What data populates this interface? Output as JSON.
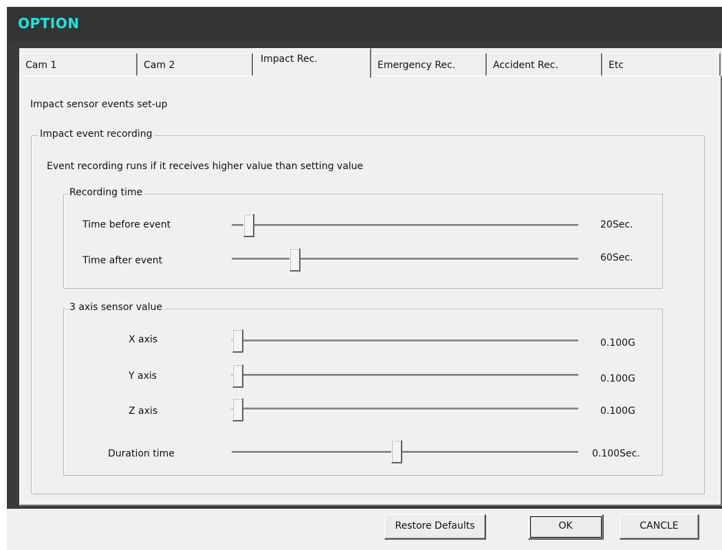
{
  "window": {
    "title": "OPTION",
    "title_color": "#1ee3e3"
  },
  "tabs": [
    {
      "label": "Cam 1",
      "active": false
    },
    {
      "label": "Cam 2",
      "active": false
    },
    {
      "label": "Impact Rec.",
      "active": true
    },
    {
      "label": "Emergency Rec.",
      "active": false
    },
    {
      "label": "Accident Rec.",
      "active": false
    },
    {
      "label": "Etc",
      "active": false
    }
  ],
  "panel": {
    "heading": "Impact sensor events set-up",
    "impact_group": {
      "legend": "Impact event recording",
      "description": "Event recording runs if it receives higher value than setting value",
      "recording_time": {
        "legend": "Recording time",
        "sliders": [
          {
            "label": "Time before event",
            "value_text": "20Sec.",
            "position": 0.06
          },
          {
            "label": "Time after event",
            "value_text": "60Sec.",
            "position": 0.19
          }
        ]
      },
      "sensor": {
        "legend": "3 axis sensor value",
        "sliders": [
          {
            "label": "X axis",
            "value_text": "0.100G",
            "position": 0.0
          },
          {
            "label": "Y axis",
            "value_text": "0.100G",
            "position": 0.0
          },
          {
            "label": "Z axis",
            "value_text": "0.100G",
            "position": 0.0
          },
          {
            "label": "Duration time",
            "value_text": "0.100Sec.",
            "position": 0.47
          }
        ]
      }
    }
  },
  "buttons": {
    "restore": "Restore Defaults",
    "ok": "OK",
    "cancel": "CANCLE"
  }
}
